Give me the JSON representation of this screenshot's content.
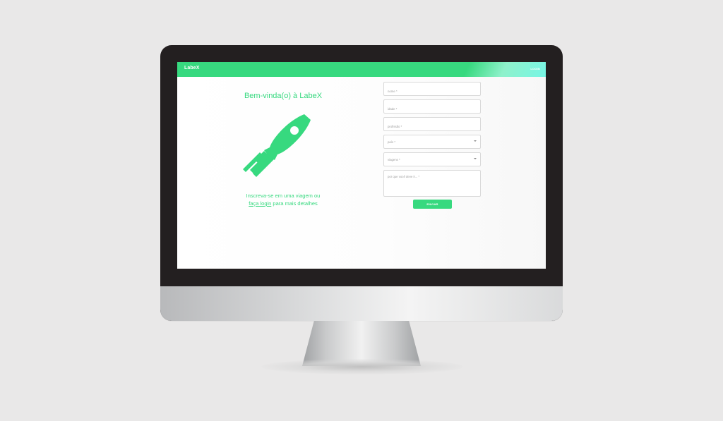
{
  "app": {
    "brand": "LabeX",
    "header_login_label": "LOGIN"
  },
  "hero": {
    "title": "Bem-vinda(o) à LabeX",
    "text_line1": "Inscreva-se em uma viagem ou",
    "login_link_text": "faça login",
    "text_line2_rest": " para mais detalhes"
  },
  "form": {
    "name_placeholder": "nome *",
    "age_placeholder": "idade *",
    "profession_placeholder": "profissão *",
    "country_placeholder": "país *",
    "trip_placeholder": "viagens *",
    "reason_placeholder": "por que você deve ir... *",
    "submit_label": "ENVIAR"
  },
  "icons": {
    "rocket": "rocket-icon",
    "dropdown": "chevron-down-icon"
  },
  "colors": {
    "accent": "#37d97f",
    "accent_light": "#77f6e5",
    "background": "#e9e8e8",
    "monitor_bezel": "#231f20"
  }
}
